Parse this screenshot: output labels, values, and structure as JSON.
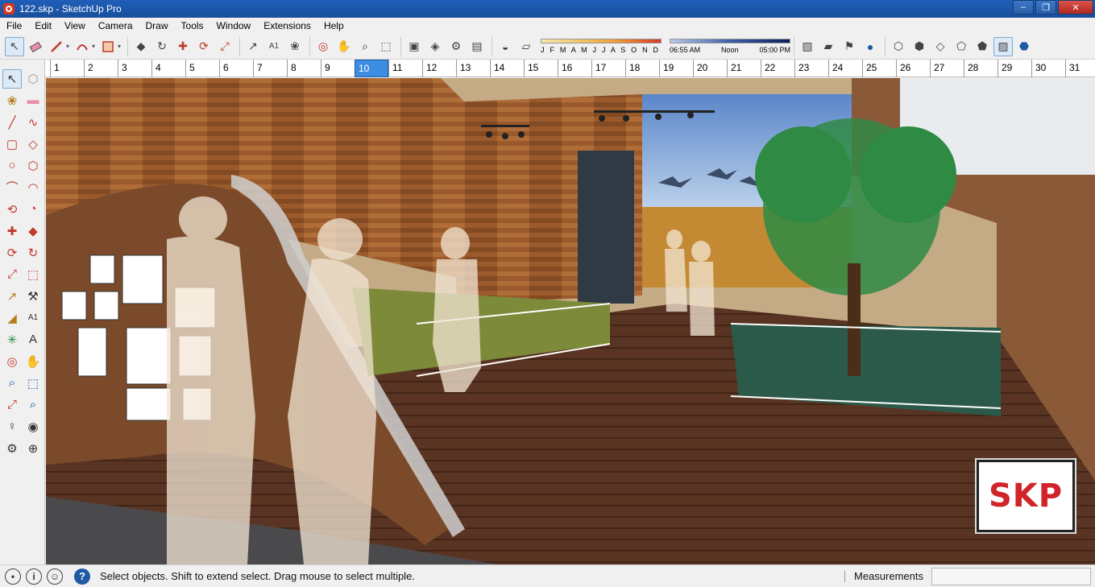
{
  "window": {
    "title": "122.skp - SketchUp Pro",
    "minimize": "–",
    "restore": "❐",
    "close": "✕"
  },
  "menu": [
    "File",
    "Edit",
    "View",
    "Camera",
    "Draw",
    "Tools",
    "Window",
    "Extensions",
    "Help"
  ],
  "toolbar": {
    "months_label": "J F M A M J J A S O N D",
    "time_start": "06:55 AM",
    "time_mid": "Noon",
    "time_end": "05:00 PM"
  },
  "ruler": {
    "selected": "10",
    "numbers": [
      "1",
      "2",
      "3",
      "4",
      "5",
      "6",
      "7",
      "8",
      "9",
      "10",
      "11",
      "12",
      "13",
      "14",
      "15",
      "16",
      "17",
      "18",
      "19",
      "20",
      "21",
      "22",
      "23",
      "24",
      "25",
      "26",
      "27",
      "28",
      "29",
      "30",
      "31"
    ]
  },
  "viewport": {
    "badge": "SKP"
  },
  "status": {
    "message": "Select objects. Shift to extend select. Drag mouse to select multiple.",
    "measurements_label": "Measurements",
    "measurements_value": ""
  },
  "colors": {
    "titlebar": "#1a4f9c",
    "selection": "#3d8ee2",
    "badge_text": "#d1232a"
  }
}
